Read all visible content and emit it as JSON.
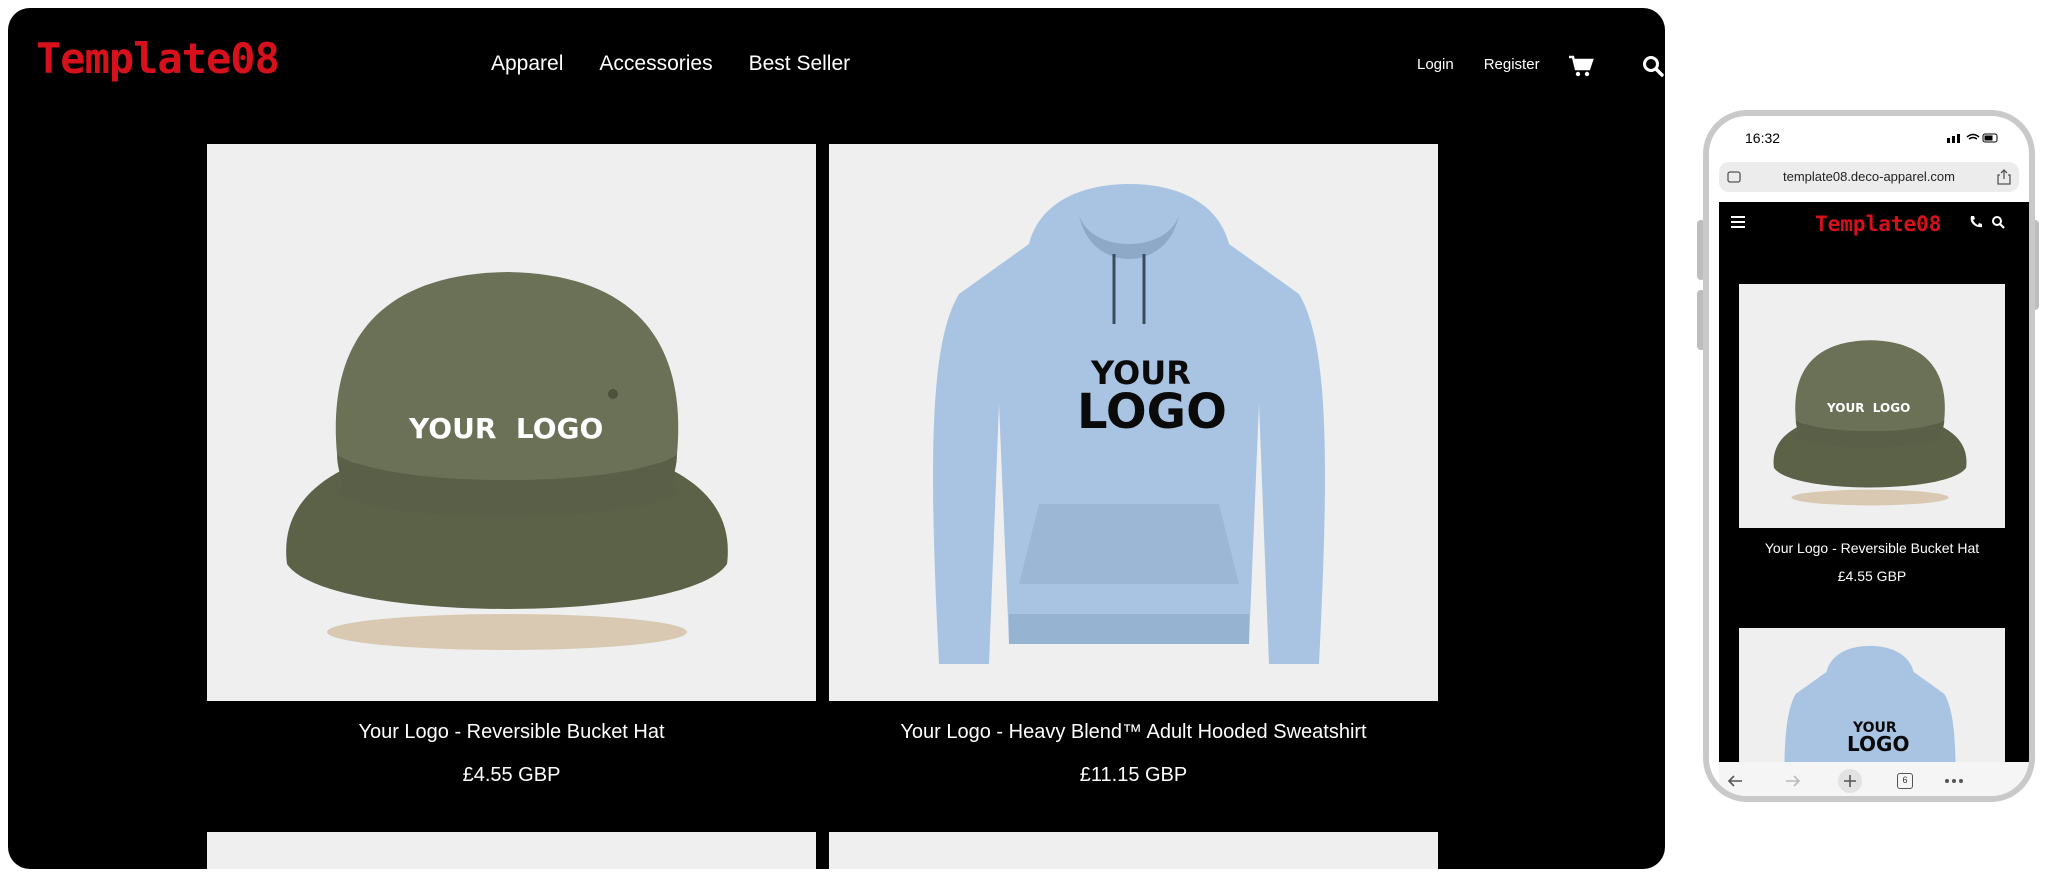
{
  "desktop": {
    "logo": "Template08",
    "nav": [
      "Apparel",
      "Accessories",
      "Best Seller"
    ],
    "account": {
      "login": "Login",
      "register": "Register"
    },
    "icons": {
      "cart": "cart-icon",
      "search": "search-icon"
    },
    "products": [
      {
        "title": "Your Logo - Reversible Bucket Hat",
        "price": "£4.55 GBP",
        "image_text": "YOUR  LOGO"
      },
      {
        "title": "Your Logo - Heavy Blend™ Adult Hooded Sweatshirt",
        "price": "£11.15 GBP",
        "image_text_1": "YOUR",
        "image_text_2": "LOGO"
      }
    ]
  },
  "mobile": {
    "time": "16:32",
    "url": "template08.deco-apparel.com",
    "logo": "Template08",
    "products": [
      {
        "title": "Your Logo - Reversible Bucket Hat",
        "price": "£4.55 GBP",
        "image_text": "YOUR  LOGO"
      },
      {
        "image_text_1": "YOUR",
        "image_text_2": "LOGO"
      }
    ],
    "tab_count": "6"
  },
  "colors": {
    "brand": "#d6111c",
    "background": "#000000",
    "card_bg": "#efefef",
    "hat": "#646b50",
    "hoodie": "#a9c4e3"
  }
}
